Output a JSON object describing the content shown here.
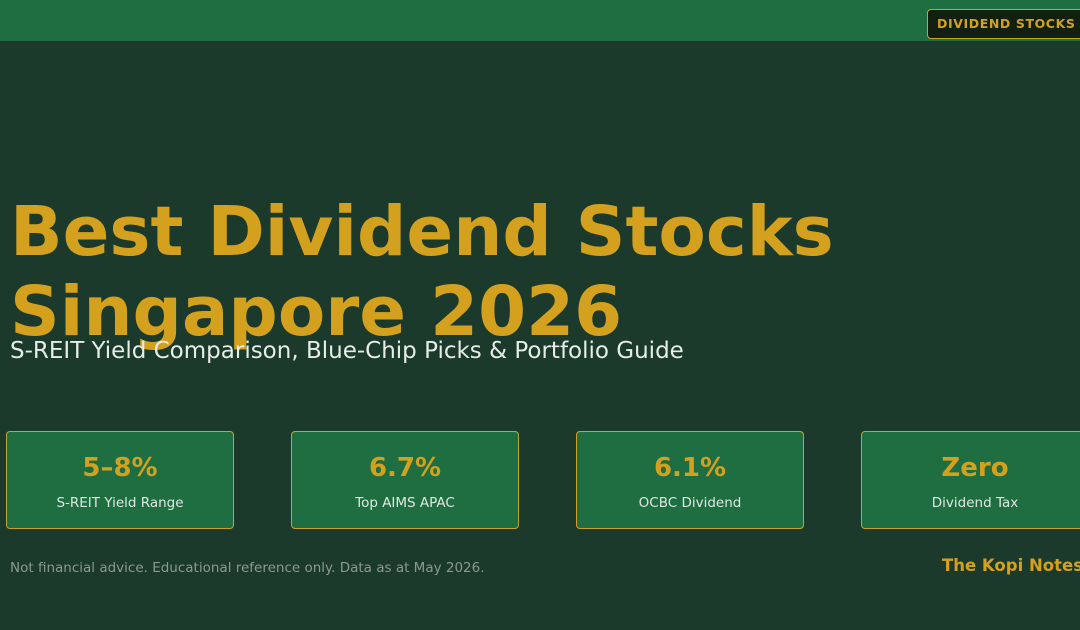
{
  "header": {
    "category_badge": "DIVIDEND STOCKS GUIDE"
  },
  "hero": {
    "title_line1": "Best Dividend Stocks",
    "title_line2": "Singapore 2026",
    "subtitle": "S-REIT Yield Comparison, Blue-Chip Picks & Portfolio Guide"
  },
  "stats": [
    {
      "value": "5–8%",
      "label": "S-REIT Yield Range"
    },
    {
      "value": "6.7%",
      "label": "Top AIMS APAC"
    },
    {
      "value": "6.1%",
      "label": "OCBC Dividend"
    },
    {
      "value": "Zero",
      "label": "Dividend Tax"
    }
  ],
  "footer": {
    "disclaimer": "Not financial advice. Educational reference only. Data as at May 2026.",
    "brand": "The Kopi Notes"
  },
  "colors": {
    "background": "#1b3a2b",
    "top_bar": "#1e6e42",
    "accent_gold": "#d4a11e",
    "card_fill": "#1e6e42"
  }
}
